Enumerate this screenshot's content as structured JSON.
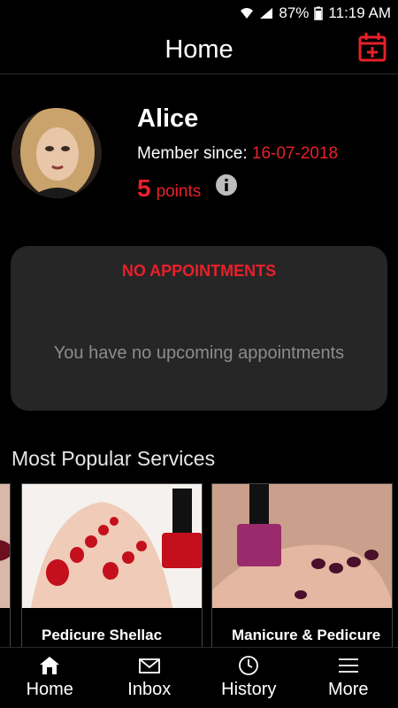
{
  "status_bar": {
    "battery": "87%",
    "time": "11:19 AM"
  },
  "header": {
    "title": "Home",
    "action_icon": "calendar-plus-icon",
    "accent_color": "#e8202a"
  },
  "profile": {
    "name": "Alice",
    "member_since_label": "Member since:",
    "member_since_date": "16-07-2018",
    "points_value": "5",
    "points_label": "points"
  },
  "appointments": {
    "heading": "NO APPOINTMENTS",
    "empty_message": "You have no upcoming appointments"
  },
  "popular_services": {
    "title": "Most Popular Services",
    "items": [
      {
        "label": ""
      },
      {
        "label": "Pedicure Shellac"
      },
      {
        "label": "Manicure & Pedicure Shellac"
      }
    ]
  },
  "bottom_nav": [
    {
      "label": "Home",
      "icon": "home-icon"
    },
    {
      "label": "Inbox",
      "icon": "mail-icon"
    },
    {
      "label": "History",
      "icon": "clock-icon"
    },
    {
      "label": "More",
      "icon": "menu-icon"
    }
  ]
}
